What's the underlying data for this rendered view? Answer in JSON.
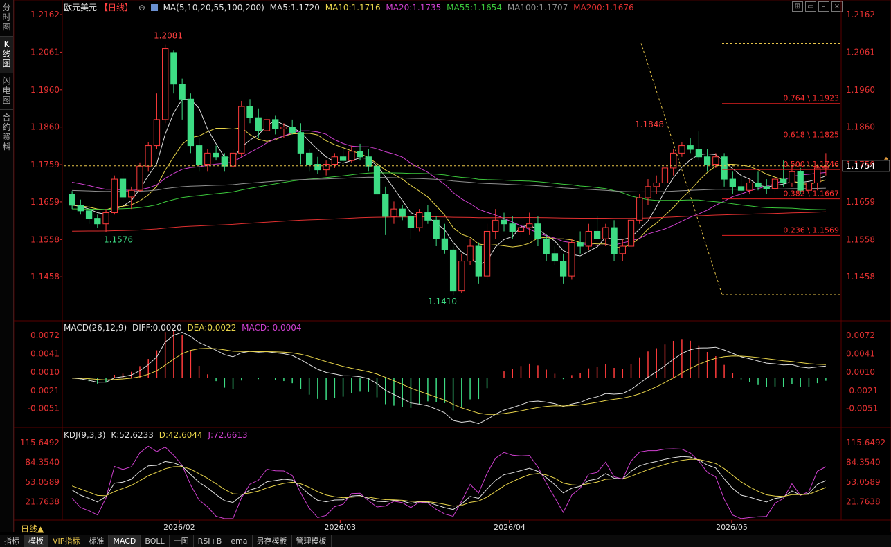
{
  "left_tabs": [
    "分时图",
    "K线图",
    "闪电图",
    "合约资料"
  ],
  "active_left_tab": 1,
  "header": {
    "symbol": "欧元美元",
    "period_tag": "【日线】",
    "ma_params": "MA(5,10,20,55,100,200)",
    "ma_values": [
      {
        "label": "MA5:1.1720",
        "color": "#e0e0e0"
      },
      {
        "label": "MA10:1.1716",
        "color": "#e8d44a"
      },
      {
        "label": "MA20:1.1735",
        "color": "#d040d0"
      },
      {
        "label": "MA55:1.1654",
        "color": "#3cc83c"
      },
      {
        "label": "MA100:1.1707",
        "color": "#909090"
      },
      {
        "label": "MA200:1.1676",
        "color": "#e03030"
      }
    ]
  },
  "window_icons": [
    "grid-icon",
    "window-icon",
    "minimize-icon",
    "close-icon"
  ],
  "colors": {
    "up": "#ff3b3b",
    "down": "#3ddc84",
    "axis": "#e03030",
    "grid": "#3a0000",
    "price_line": "#e8c54a",
    "fib": "#e02020"
  },
  "price_axis_labels": [
    "1.2162",
    "1.2061",
    "1.1960",
    "1.1860",
    "1.1759",
    "1.1659",
    "1.1558",
    "1.1458"
  ],
  "price_axis_values": [
    1.2162,
    1.2061,
    1.196,
    1.186,
    1.1759,
    1.1659,
    1.1558,
    1.1458
  ],
  "current_price": "1.1754",
  "annotations": {
    "high": "1.2081",
    "low_start": "1.1576",
    "low": "1.1410",
    "recent_high": "1.1848"
  },
  "fib_levels": [
    {
      "label": "0.764 \\ 1.1923",
      "value": 1.1923
    },
    {
      "label": "0.618 \\ 1.1825",
      "value": 1.1825
    },
    {
      "label": "0.500 \\ 1.1746",
      "value": 1.1746
    },
    {
      "label": "0.382 \\ 1.1667",
      "value": 1.1667
    },
    {
      "label": "0.236 \\ 1.1569",
      "value": 1.1569
    }
  ],
  "macd": {
    "title": "MACD(26,12,9)",
    "diff": "DIFF:0.0020",
    "dea": "DEA:0.0022",
    "macd": "MACD:-0.0004",
    "axis_labels": [
      "0.0072",
      "0.0041",
      "0.0010",
      "-0.0021",
      "-0.0051"
    ],
    "axis_values": [
      0.0072,
      0.0041,
      0.001,
      -0.0021,
      -0.0051
    ]
  },
  "kdj": {
    "title": "KDJ(9,3,3)",
    "k": "K:52.6233",
    "d": "D:42.6044",
    "j": "J:72.6613",
    "axis_labels": [
      "115.6492",
      "84.3540",
      "53.0589",
      "21.7638"
    ],
    "axis_values": [
      115.6492,
      84.354,
      53.0589,
      21.7638
    ]
  },
  "date_labels": [
    "2026/02",
    "2026/03",
    "2026/04",
    "2026/05"
  ],
  "timeframe_label": "日线▲",
  "bottom_tabs": [
    {
      "label": "指标",
      "style": ""
    },
    {
      "label": "模板",
      "style": "active"
    },
    {
      "label": "VIP指标",
      "style": "vip"
    },
    {
      "label": "标准",
      "style": ""
    },
    {
      "label": "MACD",
      "style": "active"
    },
    {
      "label": "BOLL",
      "style": ""
    },
    {
      "label": "一图",
      "style": ""
    },
    {
      "label": "RSI+B",
      "style": ""
    },
    {
      "label": "ema",
      "style": ""
    },
    {
      "label": "另存模板",
      "style": ""
    },
    {
      "label": "管理模板",
      "style": ""
    }
  ],
  "chart_data": [
    {
      "type": "candlestick",
      "title": "欧元美元【日线】",
      "ylim": [
        1.141,
        1.2162
      ],
      "x_ticks": [
        "2026/02",
        "2026/03",
        "2026/04",
        "2026/05"
      ],
      "ohlc": [
        [
          1.168,
          1.1688,
          1.164,
          1.165
        ],
        [
          1.165,
          1.1665,
          1.1625,
          1.1635
        ],
        [
          1.1635,
          1.165,
          1.16,
          1.1615
        ],
        [
          1.1615,
          1.1625,
          1.159,
          1.16
        ],
        [
          1.16,
          1.164,
          1.1578,
          1.163
        ],
        [
          1.163,
          1.173,
          1.1625,
          1.172
        ],
        [
          1.172,
          1.1745,
          1.165,
          1.1672
        ],
        [
          1.1672,
          1.17,
          1.164,
          1.169
        ],
        [
          1.169,
          1.1765,
          1.1685,
          1.1755
        ],
        [
          1.1755,
          1.182,
          1.174,
          1.181
        ],
        [
          1.181,
          1.195,
          1.18,
          1.188
        ],
        [
          1.188,
          1.2081,
          1.187,
          1.207
        ],
        [
          1.206,
          1.2065,
          1.195,
          1.1975
        ],
        [
          1.1975,
          1.199,
          1.188,
          1.1935
        ],
        [
          1.1935,
          1.195,
          1.179,
          1.181
        ],
        [
          1.181,
          1.183,
          1.174,
          1.176
        ],
        [
          1.176,
          1.18,
          1.174,
          1.179
        ],
        [
          1.179,
          1.181,
          1.177,
          1.178
        ],
        [
          1.178,
          1.179,
          1.174,
          1.1755
        ],
        [
          1.1755,
          1.18,
          1.1745,
          1.179
        ],
        [
          1.179,
          1.193,
          1.178,
          1.1915
        ],
        [
          1.1915,
          1.1935,
          1.187,
          1.1885
        ],
        [
          1.1885,
          1.191,
          1.183,
          1.185
        ],
        [
          1.185,
          1.1895,
          1.184,
          1.188
        ],
        [
          1.188,
          1.189,
          1.184,
          1.1855
        ],
        [
          1.1855,
          1.187,
          1.183,
          1.186
        ],
        [
          1.186,
          1.188,
          1.184,
          1.1845
        ],
        [
          1.1845,
          1.187,
          1.176,
          1.179
        ],
        [
          1.179,
          1.18,
          1.174,
          1.176
        ],
        [
          1.176,
          1.178,
          1.1735,
          1.1745
        ],
        [
          1.1745,
          1.177,
          1.173,
          1.176
        ],
        [
          1.176,
          1.179,
          1.175,
          1.178
        ],
        [
          1.178,
          1.18,
          1.176,
          1.177
        ],
        [
          1.177,
          1.181,
          1.1765,
          1.1795
        ],
        [
          1.1795,
          1.1815,
          1.177,
          1.178
        ],
        [
          1.178,
          1.18,
          1.174,
          1.1755
        ],
        [
          1.1755,
          1.1765,
          1.166,
          1.168
        ],
        [
          1.168,
          1.17,
          1.157,
          1.162
        ],
        [
          1.162,
          1.166,
          1.16,
          1.164
        ],
        [
          1.164,
          1.165,
          1.161,
          1.162
        ],
        [
          1.162,
          1.1635,
          1.156,
          1.159
        ],
        [
          1.159,
          1.164,
          1.158,
          1.163
        ],
        [
          1.163,
          1.165,
          1.16,
          1.161
        ],
        [
          1.161,
          1.162,
          1.154,
          1.156
        ],
        [
          1.156,
          1.16,
          1.152,
          1.153
        ],
        [
          1.153,
          1.154,
          1.141,
          1.142
        ],
        [
          1.142,
          1.152,
          1.1415,
          1.15
        ],
        [
          1.15,
          1.156,
          1.149,
          1.154
        ],
        [
          1.154,
          1.155,
          1.144,
          1.146
        ],
        [
          1.146,
          1.16,
          1.145,
          1.158
        ],
        [
          1.158,
          1.164,
          1.156,
          1.161
        ],
        [
          1.161,
          1.163,
          1.158,
          1.16
        ],
        [
          1.16,
          1.162,
          1.156,
          1.158
        ],
        [
          1.158,
          1.16,
          1.155,
          1.159
        ],
        [
          1.159,
          1.163,
          1.157,
          1.16
        ],
        [
          1.16,
          1.162,
          1.154,
          1.156
        ],
        [
          1.156,
          1.157,
          1.15,
          1.152
        ],
        [
          1.152,
          1.154,
          1.149,
          1.15
        ],
        [
          1.15,
          1.152,
          1.144,
          1.146
        ],
        [
          1.146,
          1.156,
          1.145,
          1.155
        ],
        [
          1.155,
          1.158,
          1.152,
          1.154
        ],
        [
          1.154,
          1.16,
          1.153,
          1.158
        ],
        [
          1.158,
          1.162,
          1.156,
          1.156
        ],
        [
          1.156,
          1.16,
          1.154,
          1.159
        ],
        [
          1.159,
          1.161,
          1.15,
          1.152
        ],
        [
          1.152,
          1.156,
          1.15,
          1.154
        ],
        [
          1.154,
          1.162,
          1.153,
          1.161
        ],
        [
          1.161,
          1.168,
          1.16,
          1.167
        ],
        [
          1.167,
          1.172,
          1.165,
          1.17
        ],
        [
          1.17,
          1.173,
          1.168,
          1.171
        ],
        [
          1.171,
          1.176,
          1.17,
          1.175
        ],
        [
          1.175,
          1.18,
          1.173,
          1.179
        ],
        [
          1.179,
          1.182,
          1.178,
          1.181
        ],
        [
          1.181,
          1.183,
          1.179,
          1.18
        ],
        [
          1.18,
          1.1848,
          1.177,
          1.178
        ],
        [
          1.178,
          1.18,
          1.174,
          1.176
        ],
        [
          1.176,
          1.179,
          1.175,
          1.178
        ],
        [
          1.178,
          1.179,
          1.17,
          1.172
        ],
        [
          1.172,
          1.174,
          1.168,
          1.17
        ],
        [
          1.17,
          1.173,
          1.167,
          1.169
        ],
        [
          1.169,
          1.172,
          1.168,
          1.171
        ],
        [
          1.171,
          1.174,
          1.169,
          1.17
        ],
        [
          1.17,
          1.172,
          1.168,
          1.1695
        ],
        [
          1.1695,
          1.173,
          1.168,
          1.172
        ],
        [
          1.172,
          1.177,
          1.17,
          1.171
        ],
        [
          1.171,
          1.176,
          1.17,
          1.174
        ],
        [
          1.174,
          1.175,
          1.168,
          1.169
        ],
        [
          1.169,
          1.172,
          1.168,
          1.171
        ],
        [
          1.171,
          1.176,
          1.169,
          1.175
        ],
        [
          1.175,
          1.179,
          1.173,
          1.1754
        ]
      ]
    }
  ]
}
